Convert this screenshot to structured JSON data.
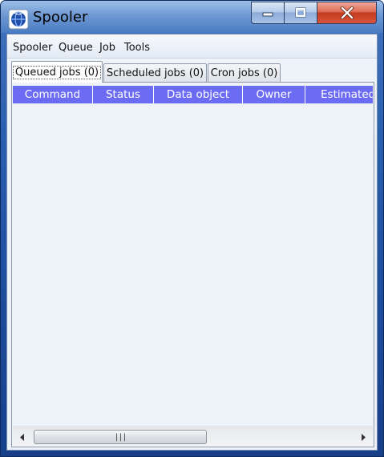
{
  "window": {
    "title": "Spooler",
    "icon": "spooler-globe-icon"
  },
  "titlebar_buttons": {
    "minimize_icon": "minimize-icon",
    "maximize_icon": "maximize-icon",
    "close_icon": "close-icon"
  },
  "menubar": {
    "items": [
      {
        "label": "Spooler"
      },
      {
        "label": "Queue"
      },
      {
        "label": "Job"
      },
      {
        "label": "Tools"
      }
    ]
  },
  "tabs": [
    {
      "label": "Queued jobs (0)",
      "active": true
    },
    {
      "label": "Scheduled jobs (0)",
      "active": false
    },
    {
      "label": "Cron jobs (0)",
      "active": false
    }
  ],
  "table": {
    "columns": [
      "Command",
      "Status",
      "Data object",
      "Owner",
      "Estimated"
    ],
    "rows": []
  },
  "scrollbar": {
    "left_arrow": "scroll-left-icon",
    "right_arrow": "scroll-right-icon",
    "grip": "|||"
  },
  "colors": {
    "header_bg": "#6b6bf4",
    "header_text": "#ffffff",
    "close_button": "#c33c21"
  }
}
